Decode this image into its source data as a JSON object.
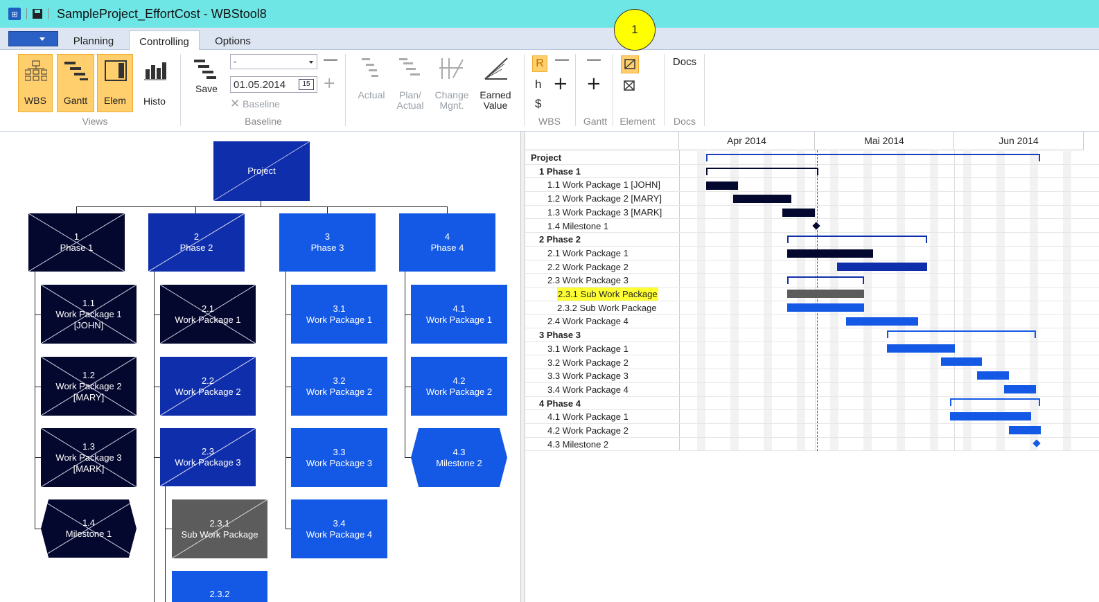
{
  "window": {
    "title": "SampleProject_EffortCost - WBStool8"
  },
  "tabs": [
    "Planning",
    "Controlling",
    "Options"
  ],
  "ribbon": {
    "views": {
      "wbs": "WBS",
      "gantt": "Gantt",
      "elem": "Elem",
      "histo": "Histo",
      "group": "Views"
    },
    "baseline": {
      "save": "Save",
      "combo_value": "-",
      "date": "01.05.2014",
      "calendar": "15",
      "baseline_btn": "Baseline",
      "group": "Baseline"
    },
    "controlling": {
      "actual": "Actual",
      "plan_actual_1": "Plan/",
      "plan_actual_2": "Actual",
      "change_1": "Change",
      "change_2": "Mgnt.",
      "earned_1": "Earned",
      "earned_2": "Value"
    },
    "wbs_group": {
      "r": "R",
      "h": "h",
      "dollar": "$",
      "group": "WBS"
    },
    "gantt_group": {
      "group": "Gantt"
    },
    "element_group": {
      "group": "Element"
    },
    "docs": {
      "label": "Docs",
      "group": "Docs"
    }
  },
  "callout": "1",
  "wbs": {
    "project": "Project",
    "phases": [
      {
        "num": "1",
        "name": "Phase 1"
      },
      {
        "num": "2",
        "name": "Phase 2"
      },
      {
        "num": "3",
        "name": "Phase 3"
      },
      {
        "num": "4",
        "name": "Phase 4"
      }
    ],
    "items": [
      {
        "num": "1.1",
        "l1": "Work Package 1",
        "l2": "[JOHN]"
      },
      {
        "num": "1.2",
        "l1": "Work Package 2",
        "l2": "[MARY]"
      },
      {
        "num": "1.3",
        "l1": "Work Package 3",
        "l2": "[MARK]"
      },
      {
        "num": "1.4",
        "l1": "Milestone 1",
        "l2": ""
      },
      {
        "num": "2.1",
        "l1": "Work Package 1",
        "l2": ""
      },
      {
        "num": "2.2",
        "l1": "Work Package 2",
        "l2": ""
      },
      {
        "num": "2.3",
        "l1": "Work Package 3",
        "l2": ""
      },
      {
        "num": "2.3.1",
        "l1": "Sub Work Package",
        "l2": ""
      },
      {
        "num": "2.3.2",
        "l1": "",
        "l2": ""
      },
      {
        "num": "3.1",
        "l1": "Work Package 1",
        "l2": ""
      },
      {
        "num": "3.2",
        "l1": "Work Package 2",
        "l2": ""
      },
      {
        "num": "3.3",
        "l1": "Work Package 3",
        "l2": ""
      },
      {
        "num": "3.4",
        "l1": "Work Package 4",
        "l2": ""
      },
      {
        "num": "4.1",
        "l1": "Work Package 1",
        "l2": ""
      },
      {
        "num": "4.2",
        "l1": "Work Package 2",
        "l2": ""
      },
      {
        "num": "4.3",
        "l1": "Milestone 2",
        "l2": ""
      }
    ]
  },
  "gantt": {
    "months": [
      "Apr 2014",
      "Mai 2014",
      "Jun 2014"
    ],
    "rows": [
      {
        "label": "Project",
        "bold": true,
        "indent": 0
      },
      {
        "label": "1 Phase 1",
        "bold": true,
        "indent": 1
      },
      {
        "label": "1.1 Work Package 1 [JOHN]",
        "bold": false,
        "indent": 2
      },
      {
        "label": "1.2 Work Package 2 [MARY]",
        "bold": false,
        "indent": 2
      },
      {
        "label": "1.3 Work Package 3 [MARK]",
        "bold": false,
        "indent": 2
      },
      {
        "label": "1.4 Milestone 1",
        "bold": false,
        "indent": 2
      },
      {
        "label": "2 Phase 2",
        "bold": true,
        "indent": 1
      },
      {
        "label": "2.1 Work Package 1",
        "bold": false,
        "indent": 2
      },
      {
        "label": "2.2 Work Package 2",
        "bold": false,
        "indent": 2
      },
      {
        "label": "2.3 Work Package 3",
        "bold": false,
        "indent": 2
      },
      {
        "label": "2.3.1 Sub Work Package",
        "bold": false,
        "indent": 3,
        "highlight": true
      },
      {
        "label": "2.3.2 Sub Work Package",
        "bold": false,
        "indent": 3
      },
      {
        "label": "2.4 Work Package 4",
        "bold": false,
        "indent": 2
      },
      {
        "label": "3 Phase 3",
        "bold": true,
        "indent": 1
      },
      {
        "label": "3.1 Work Package 1",
        "bold": false,
        "indent": 2
      },
      {
        "label": "3.2 Work Package 2",
        "bold": false,
        "indent": 2
      },
      {
        "label": "3.3 Work Package 3",
        "bold": false,
        "indent": 2
      },
      {
        "label": "3.4 Work Package 4",
        "bold": false,
        "indent": 2
      },
      {
        "label": "4 Phase 4",
        "bold": true,
        "indent": 1
      },
      {
        "label": "4.1 Work Package 1",
        "bold": false,
        "indent": 2
      },
      {
        "label": "4.2 Work Package 2",
        "bold": false,
        "indent": 2
      },
      {
        "label": "4.3 Milestone 2",
        "bold": false,
        "indent": 2
      }
    ]
  },
  "colors": {
    "dark": "#05082e",
    "mid": "#0f2eab",
    "light": "#1459e6",
    "gray": "#5c5c5c",
    "highlight": "#ffff33",
    "today_line": "#e02020",
    "active_button": "#ffcf6e"
  }
}
